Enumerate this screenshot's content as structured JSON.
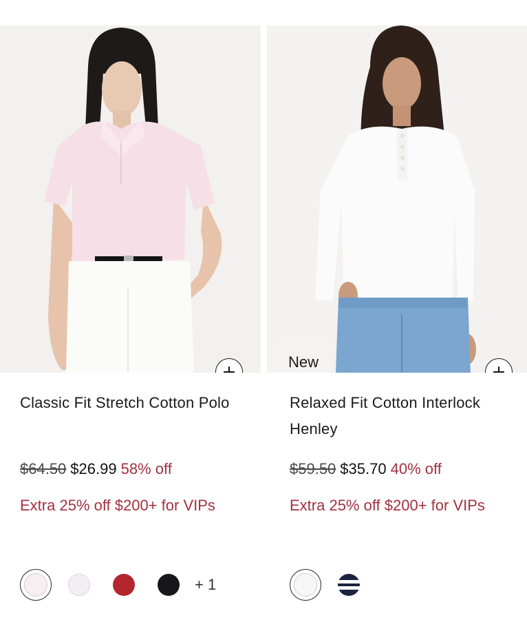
{
  "products": [
    {
      "title": "Classic Fit Stretch Cotton Polo",
      "price_original": "$64.50",
      "price_sale": "$26.99",
      "discount": "58% off",
      "promo": "Extra 25% off $200+ for VIPs",
      "badge": "",
      "add_icon": "plus-icon",
      "swatches": [
        {
          "color": "#f6eef0",
          "selected": true
        },
        {
          "color": "#f3eef4",
          "selected": false
        },
        {
          "color": "#b3262e",
          "selected": false
        },
        {
          "color": "#17171b",
          "selected": false
        }
      ],
      "more_colors": "+ 1"
    },
    {
      "title": "Relaxed Fit Cotton Interlock Henley",
      "price_original": "$59.50",
      "price_sale": "$35.70",
      "discount": "40% off",
      "promo": "Extra 25% off $200+ for VIPs",
      "badge": "New",
      "add_icon": "plus-icon",
      "swatches": [
        {
          "color": "#f7f7f7",
          "selected": true
        },
        {
          "color": "striped-navy-white",
          "selected": false
        }
      ],
      "more_colors": ""
    }
  ],
  "colors": {
    "accent_red": "#a3303f",
    "text": "#1a1a1a"
  }
}
